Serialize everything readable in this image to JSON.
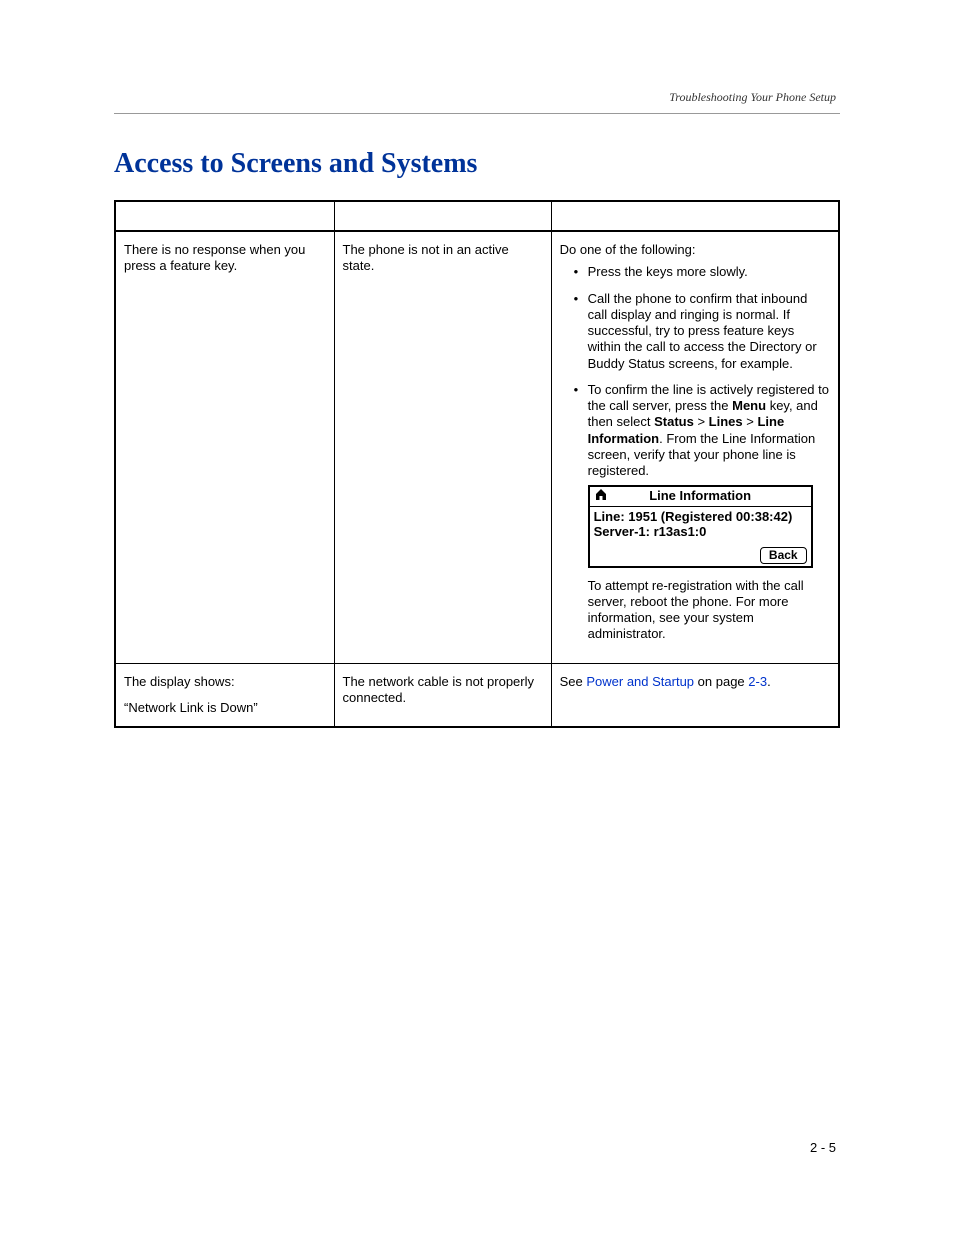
{
  "header": {
    "section": "Troubleshooting Your Phone Setup"
  },
  "title": "Access to Screens and Systems",
  "table": {
    "rows": [
      {
        "symptom": {
          "line1": "There is no response when you press a feature key."
        },
        "cause": "The phone is not in an active state.",
        "action": {
          "lead": "Do one of the following:",
          "b1": "Press the keys more slowly.",
          "b2": "Call the phone to confirm that inbound call display and ringing is normal. If successful, try to press feature keys within the call to access the Directory or Buddy Status screens, for example.",
          "b3": {
            "p1": "To confirm the line is actively registered to the call server, press the ",
            "menu_key": "Menu",
            "p2": " key, and then select ",
            "status": "Status",
            "gt1": " > ",
            "lines": "Lines",
            "gt2": " > ",
            "lineinfo": "Line Information",
            "p3": ". From the Line Information screen, verify that your phone line is registered.",
            "lcd": {
              "title": "Line Information",
              "l1": "Line: 1951 (Registered 00:38:42)",
              "l2": "Server-1: r13as1:0",
              "back": "Back"
            },
            "p4": "To attempt re-registration with the call server, reboot the phone. For more information, see your system administrator."
          }
        }
      },
      {
        "symptom": {
          "line1": "The display shows:",
          "line2": "“Network Link is Down”"
        },
        "cause": "The network cable is not properly connected.",
        "action": {
          "see": "See ",
          "link": "Power and Startup",
          "page_pre": " on page ",
          "page_link": "2-3",
          "period": "."
        }
      }
    ]
  },
  "page_number": "2 - 5"
}
